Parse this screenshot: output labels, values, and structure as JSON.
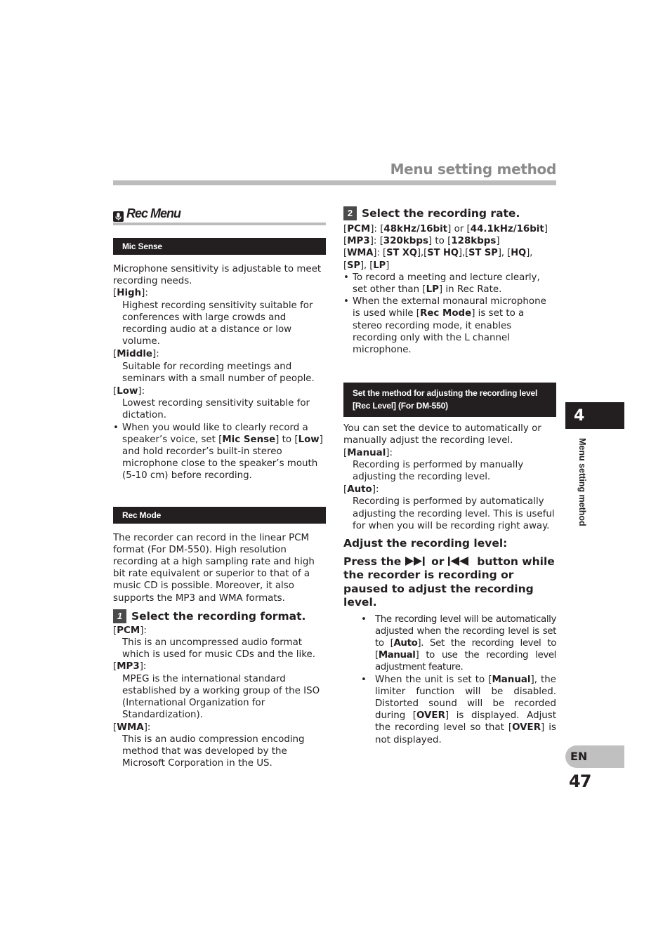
{
  "header": {
    "title": "Menu setting method"
  },
  "left": {
    "rec_menu": {
      "icon": "microphone-icon",
      "label": "Rec Menu"
    },
    "mic_sense": {
      "heading": "Mic Sense",
      "intro": "Microphone sensitivity is adjustable to meet recording needs.",
      "options": [
        {
          "name": "High",
          "desc": "Highest recording sensitivity suitable for conferences with large crowds and recording audio at a distance or low volume."
        },
        {
          "name": "Middle",
          "desc": "Suitable for recording meetings and seminars with a small number of people."
        },
        {
          "name": "Low",
          "desc": "Lowest recording sensitivity suitable for dictation."
        }
      ],
      "note": {
        "bullet": "•",
        "t1": "When you would like to clearly record a speaker’s voice, set [",
        "b1": "Mic Sense",
        "t2": "] to [",
        "b2": "Low",
        "t3": "] and hold recorder’s built-in stereo microphone close to the speaker’s mouth (5-10 cm) before recording."
      }
    },
    "rec_mode": {
      "heading": "Rec Mode",
      "intro": "The recorder can record in the linear PCM format (For DM-550). High resolution recording at a high sampling rate and high bit rate equivalent or superior to that of a music CD is possible. Moreover, it also supports the MP3 and WMA formats.",
      "step": {
        "number": "1",
        "label": "Select the recording format."
      },
      "formats": [
        {
          "name": "PCM",
          "desc": "This is an uncompressed audio format which is used for music CDs and the like."
        },
        {
          "name": "MP3",
          "desc": "MPEG is the international standard established by a working group of the ISO (International Organization for Standardization)."
        },
        {
          "name": "WMA",
          "desc": "This is an audio compression encoding method that was developed by the Microsoft Corporation in the US."
        }
      ]
    }
  },
  "right": {
    "step2": {
      "number": "2",
      "label": "Select the recording rate."
    },
    "rates": {
      "pcm": {
        "name": "PCM",
        "v1": "48kHz/16bit",
        "sep": "or",
        "v2": "44.1kHz/16bit"
      },
      "mp3": {
        "name": "MP3",
        "v1": "320kbps",
        "sep": "to",
        "v2": "128kbps"
      },
      "wma": {
        "name": "WMA",
        "values": [
          "ST XQ",
          "ST HQ",
          "ST SP",
          "HQ",
          "SP",
          "LP"
        ]
      }
    },
    "notes": [
      {
        "t1": "To record a meeting and lecture clearly, set other than [",
        "b1": "LP",
        "t2": "] in Rec Rate."
      },
      {
        "t1": "When the external monaural microphone is used while [",
        "b1": "Rec Mode",
        "t2": "] is set to a stereo recording mode, it enables recording only with the L channel microphone."
      }
    ],
    "rec_level": {
      "heading_line1": "Set the method for adjusting the recording level",
      "heading_line2": "[Rec Level] (For DM-550)",
      "intro": "You can set the device to automatically or manually adjust the recording level.",
      "options": [
        {
          "name": "Manual",
          "desc": "Recording is performed by manually adjusting the recording level."
        },
        {
          "name": "Auto",
          "desc": "Recording is performed by automatically adjusting the recording level. This is useful for when you will be recording right away."
        }
      ],
      "adjust_heading": "Adjust the recording level:",
      "press": {
        "t1": "Press the",
        "icon1": "fast-forward-icon",
        "t2": "or",
        "icon2": "rewind-icon",
        "t3": "button while the recorder is recording or paused to adjust the recording level."
      },
      "bullets": [
        {
          "t1": "The recording level will be automatically adjusted when the recording level is set to [",
          "b1": "Auto",
          "t2": "]. Set the recording level to [",
          "b2": "Manual",
          "t3": "] to use the recording level adjustment feature."
        },
        {
          "t1": "When the unit is set to [",
          "b1": "Manual",
          "t2": "], the limiter function will be disabled. Distorted sound will be recorded during [",
          "b2": "OVER",
          "t3": "] is displayed. Adjust the recording level so that [",
          "b3": "OVER",
          "t4": "] is not displayed."
        }
      ]
    }
  },
  "sidebar": {
    "chapter_number": "4",
    "chapter_title": "Menu setting method",
    "language": "EN",
    "page_number": "47"
  }
}
